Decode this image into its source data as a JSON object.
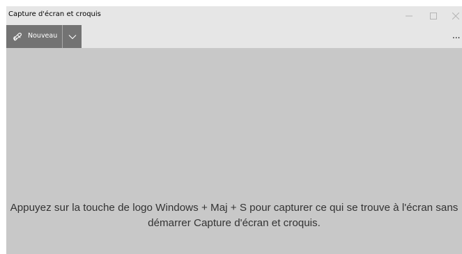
{
  "window": {
    "title": "Capture d'écran et croquis"
  },
  "titlebar_controls": {
    "minimize_icon": "minimize-icon",
    "maximize_icon": "maximize-icon",
    "close_icon": "close-icon"
  },
  "toolbar": {
    "new_label": "Nouveau",
    "new_icon": "snip-icon",
    "dropdown_icon": "chevron-down-icon",
    "more_label": "..."
  },
  "main": {
    "hint": "Appuyez sur la touche de logo Windows + Maj + S pour capturer ce qui se trouve à l'écran sans démarrer Capture d'écran et croquis."
  },
  "colors": {
    "titlebar_bg": "#e6e6e6",
    "canvas_bg": "#c8c8c8",
    "button_bg": "#737373"
  }
}
